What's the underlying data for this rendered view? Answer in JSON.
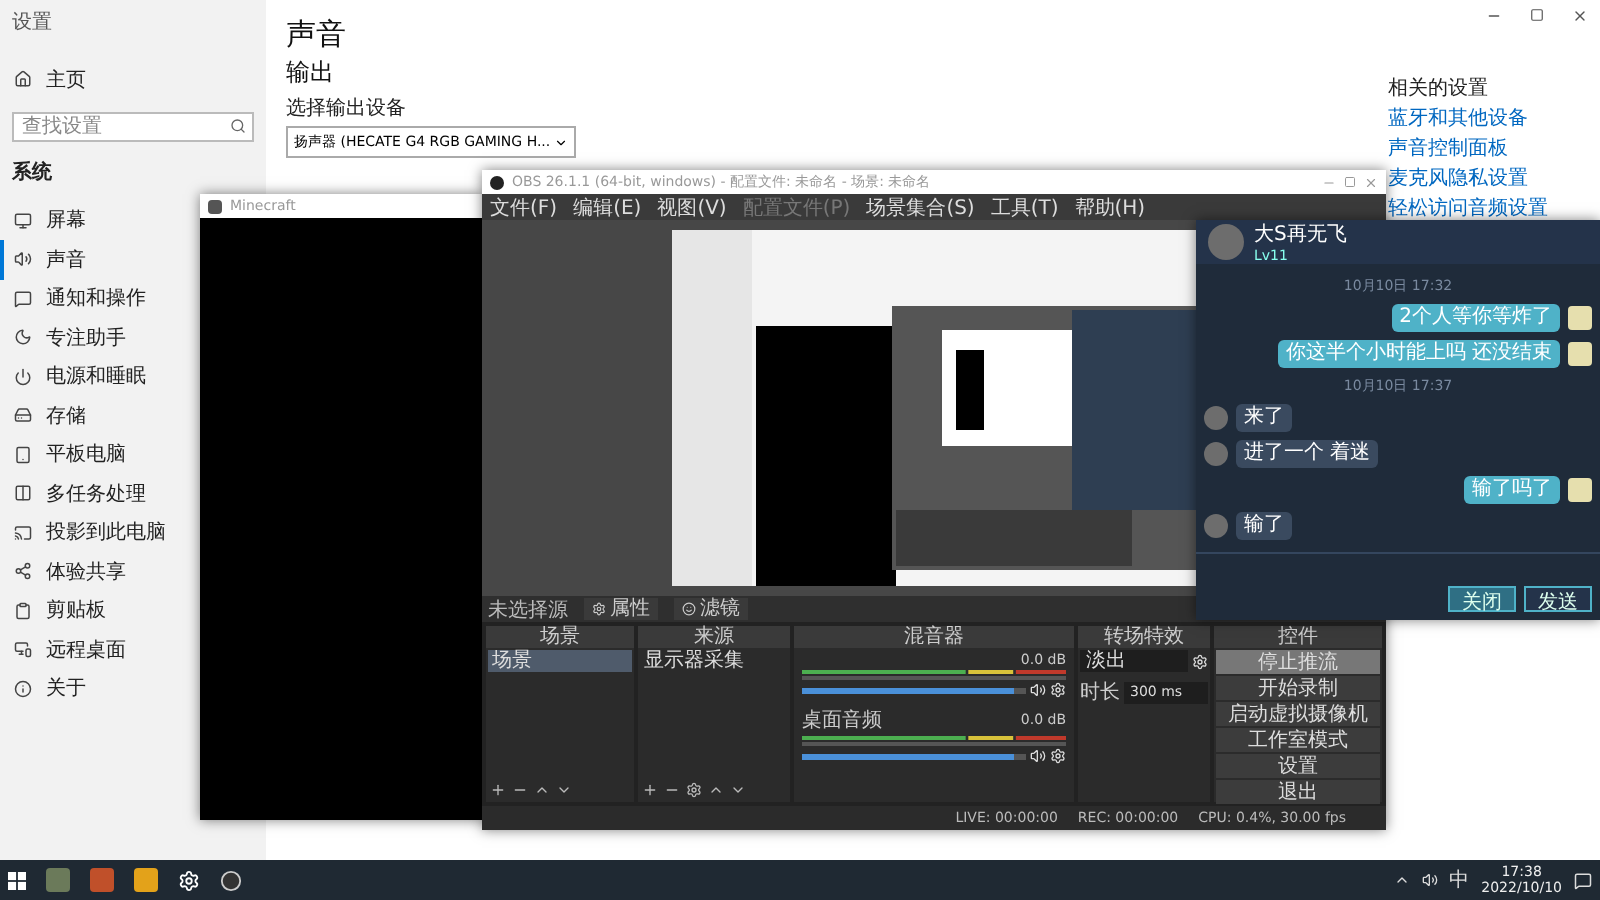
{
  "settings": {
    "title": "设置",
    "home": "主页",
    "search_placeholder": "查找设置",
    "section": "系统",
    "nav": [
      {
        "label": "屏幕",
        "selected": false
      },
      {
        "label": "声音",
        "selected": true
      },
      {
        "label": "通知和操作",
        "selected": false
      },
      {
        "label": "专注助手",
        "selected": false
      },
      {
        "label": "电源和睡眠",
        "selected": false
      },
      {
        "label": "存储",
        "selected": false
      },
      {
        "label": "平板电脑",
        "selected": false
      },
      {
        "label": "多任务处理",
        "selected": false
      },
      {
        "label": "投影到此电脑",
        "selected": false
      },
      {
        "label": "体验共享",
        "selected": false
      },
      {
        "label": "剪贴板",
        "selected": false
      },
      {
        "label": "远程桌面",
        "selected": false
      },
      {
        "label": "关于",
        "selected": false
      }
    ],
    "page_title": "声音",
    "output_heading": "输出",
    "device_label": "选择输出设备",
    "device_value": "扬声器 (HECATE G4 RGB GAMING H...",
    "related_heading": "相关的设置",
    "related_links": [
      "蓝牙和其他设备",
      "声音控制面板",
      "麦克风隐私设置",
      "轻松访问音频设置"
    ]
  },
  "minecraft": {
    "title": "Minecraft"
  },
  "obs": {
    "title": "OBS 26.1.1 (64-bit, windows) - 配置文件: 未命名 - 场景: 未命名",
    "menus": [
      {
        "label": "文件(F)",
        "disabled": false
      },
      {
        "label": "编辑(E)",
        "disabled": false
      },
      {
        "label": "视图(V)",
        "disabled": false
      },
      {
        "label": "配置文件(P)",
        "disabled": true
      },
      {
        "label": "场景集合(S)",
        "disabled": false
      },
      {
        "label": "工具(T)",
        "disabled": false
      },
      {
        "label": "帮助(H)",
        "disabled": false
      }
    ],
    "source_bar": {
      "label": "未选择源",
      "buttons": [
        "属性",
        "滤镜"
      ]
    },
    "scenes": {
      "title": "场景",
      "items": [
        {
          "label": "场景",
          "selected": true
        }
      ]
    },
    "sources": {
      "title": "来源",
      "items": [
        "显示器采集"
      ]
    },
    "mixer": {
      "title": "混音器",
      "tracks": [
        {
          "reading": "0.0 dB",
          "level": 0.95
        },
        {
          "name": "桌面音频",
          "reading": "0.0 dB",
          "level": 0.95
        }
      ]
    },
    "transitions": {
      "title": "转场特效",
      "type": "淡出",
      "duration_label": "时长",
      "duration": "300 ms"
    },
    "controls": {
      "title": "控件",
      "buttons": [
        {
          "label": "停止推流",
          "active": true
        },
        {
          "label": "开始录制",
          "active": false
        },
        {
          "label": "启动虚拟摄像机",
          "active": false
        },
        {
          "label": "工作室模式",
          "active": false
        },
        {
          "label": "设置",
          "active": false
        },
        {
          "label": "退出",
          "active": false
        }
      ]
    },
    "status": {
      "live": "LIVE: 00:00:00",
      "rec": "REC: 00:00:00",
      "cpu": "CPU: 0.4%, 30.00 fps"
    }
  },
  "chat": {
    "name": "大S再无飞",
    "badge": "Lv11",
    "messages": [
      {
        "kind": "time",
        "text": "10月10日 17:32"
      },
      {
        "kind": "out",
        "text": "2个人等你等炸了"
      },
      {
        "kind": "out",
        "text": "你这半个小时能上吗 还没结束"
      },
      {
        "kind": "time",
        "text": "10月10日 17:37"
      },
      {
        "kind": "in",
        "text": "来了"
      },
      {
        "kind": "in",
        "text": "进了一个 着迷"
      },
      {
        "kind": "out",
        "text": "输了吗了"
      },
      {
        "kind": "in",
        "text": "输了"
      }
    ],
    "buttons": [
      {
        "label": "关闭",
        "primary": true
      },
      {
        "label": "发送",
        "primary": false
      }
    ]
  },
  "taskbar": {
    "ime": "中",
    "time": "17:38",
    "date": "2022/10/10"
  }
}
